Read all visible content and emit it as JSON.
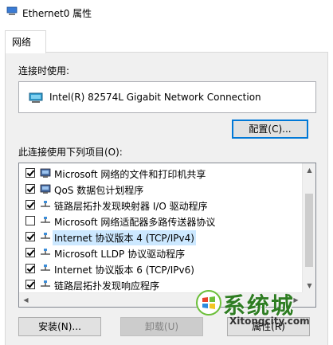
{
  "window": {
    "title": "Ethernet0 属性",
    "icon": "network-adapter-icon"
  },
  "tabs": [
    {
      "label": "网络",
      "active": true
    }
  ],
  "connect_using": {
    "label": "连接时使用:",
    "adapter_name": "Intel(R) 82574L Gigabit Network Connection",
    "configure_button": "配置(C)..."
  },
  "items_section": {
    "label": "此连接使用下列项目(O):",
    "items": [
      {
        "label": "Microsoft 网络的文件和打印机共享",
        "checked": true,
        "icon": "network-service-icon"
      },
      {
        "label": "QoS 数据包计划程序",
        "checked": true,
        "icon": "network-service-icon"
      },
      {
        "label": "链路层拓扑发现映射器 I/O 驱动程序",
        "checked": true,
        "icon": "protocol-icon"
      },
      {
        "label": "Microsoft 网络适配器多路传送器协议",
        "checked": false,
        "icon": "protocol-icon"
      },
      {
        "label": "Internet 协议版本 4 (TCP/IPv4)",
        "checked": true,
        "icon": "protocol-icon",
        "selected": true
      },
      {
        "label": "Microsoft LLDP 协议驱动程序",
        "checked": true,
        "icon": "protocol-icon"
      },
      {
        "label": "Internet 协议版本 6 (TCP/IPv6)",
        "checked": true,
        "icon": "protocol-icon"
      },
      {
        "label": "链路层拓扑发现响应程序",
        "checked": true,
        "icon": "protocol-icon"
      }
    ]
  },
  "buttons": {
    "install": "安装(N)...",
    "uninstall": "卸载(U)",
    "properties": "属性(R)"
  },
  "watermark": {
    "text": "系统城",
    "domain": "Xitongcity.com"
  },
  "colors": {
    "accent": "#0078d7",
    "selection": "#cce8ff",
    "panel_bg": "#f0f0f0"
  }
}
